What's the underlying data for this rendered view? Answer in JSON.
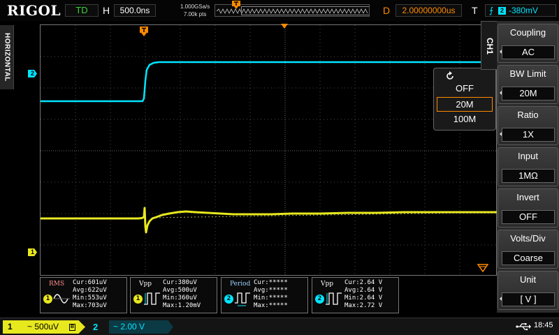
{
  "brand": "RIGOL",
  "top": {
    "run_mode": "TD",
    "h_label": "H",
    "timebase": "500.0ns",
    "sample_rate": "1.000GSa/s",
    "mem_depth": "7.00k pts",
    "d_label": "D",
    "delay": "2.00000000us",
    "t_label": "T",
    "trigger_source": "2",
    "trigger_level": "-380mV"
  },
  "side_tab": "HORIZONTAL",
  "channel_markers": {
    "ch2": "2",
    "ch1": "1"
  },
  "bw_popup": {
    "options": [
      {
        "label": "OFF",
        "selected": false
      },
      {
        "label": "20M",
        "selected": true
      },
      {
        "label": "100M",
        "selected": false
      }
    ]
  },
  "menu": {
    "title": "CH1",
    "items": [
      {
        "label": "Coupling",
        "value": "AC"
      },
      {
        "label": "BW Limit",
        "value": "20M"
      },
      {
        "label": "Ratio",
        "value": "1X"
      },
      {
        "label": "Input",
        "value": "1MΩ"
      },
      {
        "label": "Invert",
        "value": "OFF"
      },
      {
        "label": "Volts/Div",
        "value": "Coarse"
      },
      {
        "label": "Unit",
        "value": "[  V  ]"
      }
    ]
  },
  "measurements": [
    {
      "name": "RMS",
      "channel": "1",
      "lines": [
        "Cur:601uV",
        "Avg:622uV",
        "Min:553uV",
        "Max:703uV"
      ]
    },
    {
      "name": "Vpp",
      "channel": "1",
      "lines": [
        "Cur:380uV",
        "Avg:500uV",
        "Min:360uV",
        "Max:1.20mV"
      ]
    },
    {
      "name": "Period",
      "channel": "2",
      "lines": [
        "Cur:*****",
        "Avg:*****",
        "Min:*****",
        "Max:*****"
      ]
    },
    {
      "name": "Vpp",
      "channel": "2",
      "lines": [
        "Cur:2.64 V",
        "Avg:2.64 V",
        "Min:2.64 V",
        "Max:2.72 V"
      ]
    }
  ],
  "bottom": {
    "ch1_num": "1",
    "ch1_scale": "~ 500uV",
    "ch1_bw_icon": "B",
    "ch2_num": "2",
    "ch2_scale": "~  2.00 V",
    "clock": "18:45"
  },
  "colors": {
    "ch1": "#e8e81e",
    "ch2": "#00e5ff",
    "trigger": "#ff8a00",
    "run_mode": "#3cd23c"
  },
  "icons": {
    "trigger_edge": "rising-edge-icon",
    "usb": "usb-icon",
    "refresh": "refresh-icon"
  }
}
